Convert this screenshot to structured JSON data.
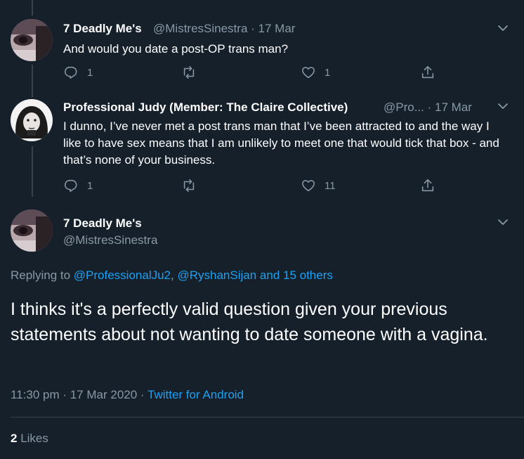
{
  "tweets": [
    {
      "display_name": "7 Deadly Me's",
      "handle": "@MistresSinestra",
      "date": "17 Mar",
      "text": "And would you date a post-OP trans man?",
      "replies": "1",
      "retweets": "",
      "likes": "1"
    },
    {
      "display_name": "Professional Judy (Member: The Claire Collective)",
      "handle": "@Pro...",
      "date": "17 Mar",
      "text": "I dunno, I’ve never met a post trans man that I’ve been attracted to and the way I like to have sex means that I am unlikely to meet one that would tick that box - and that’s none of your business.",
      "replies": "1",
      "retweets": "",
      "likes": "11"
    }
  ],
  "main_tweet": {
    "display_name": "7 Deadly Me's",
    "handle": "@MistresSinestra",
    "replying_prefix": "Replying to",
    "replying_user_1": "@ProfessionalJu2",
    "replying_separator": ",",
    "replying_rest": "@RyshanSijan and 15 others",
    "text": "I thinks it's a perfectly valid question given your previous statements about not wanting to date someone with a vagina.",
    "timestamp": "11:30 pm · 17 Mar 2020",
    "dot": "·",
    "source": "Twitter for Android",
    "likes_count": "2",
    "likes_label": "Likes"
  },
  "icons": {
    "reply": "reply-icon",
    "retweet": "retweet-icon",
    "like": "heart-icon",
    "share": "share-icon",
    "more": "chevron-down-icon"
  },
  "colors": {
    "background": "#15202b",
    "secondary_text": "#8899a6",
    "link": "#1da1f2",
    "divider": "#38444d"
  }
}
